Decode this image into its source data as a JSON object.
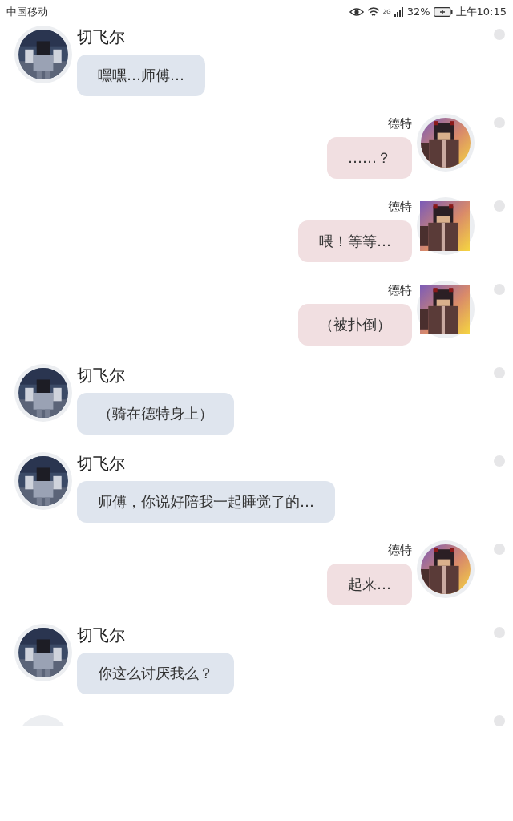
{
  "status_bar": {
    "carrier": "中国移动",
    "network": "2G",
    "battery": "32%",
    "time": "上午10:15"
  },
  "messages": [
    {
      "kind": "incoming",
      "sender": "切飞尔",
      "text": "嘿嘿…师傅…",
      "avatar": {
        "kind": "round"
      }
    },
    {
      "kind": "outgoing",
      "sender": "德特",
      "text": "……？",
      "avatar": {
        "kind": "round"
      }
    },
    {
      "kind": "outgoing",
      "sender": "德特",
      "text": "喂！等等…",
      "avatar": {
        "kind": "square"
      }
    },
    {
      "kind": "outgoing",
      "sender": "德特",
      "text": "（被扑倒）",
      "avatar": {
        "kind": "square"
      }
    },
    {
      "kind": "incoming",
      "sender": "切飞尔",
      "text": "（骑在德特身上）",
      "avatar": {
        "kind": "round"
      }
    },
    {
      "kind": "incoming",
      "sender": "切飞尔",
      "text": "师傅，你说好陪我一起睡觉了的…",
      "avatar": {
        "kind": "round"
      }
    },
    {
      "kind": "outgoing",
      "sender": "德特",
      "text": "起来…",
      "avatar": {
        "kind": "round"
      }
    },
    {
      "kind": "incoming",
      "sender": "切飞尔",
      "text": "你这么讨厌我么？",
      "avatar": {
        "kind": "round"
      }
    }
  ]
}
